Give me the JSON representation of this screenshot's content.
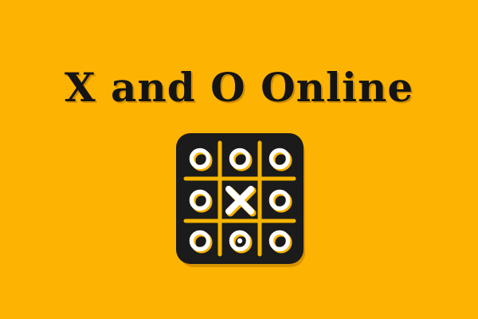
{
  "title": "X and O Online",
  "colors": {
    "background": "#FDB302",
    "tile": "#1B1B1B",
    "grid": "#F6B400",
    "mark_fill": "#FFFFFF",
    "mark_stroke": "#F6B400",
    "title_text": "#141414"
  },
  "board": {
    "icon": "tic-tac-toe-board-icon",
    "cells": [
      [
        "O",
        "O",
        "O"
      ],
      [
        "O",
        "X",
        "O"
      ],
      [
        "O",
        "o",
        "O"
      ]
    ]
  }
}
